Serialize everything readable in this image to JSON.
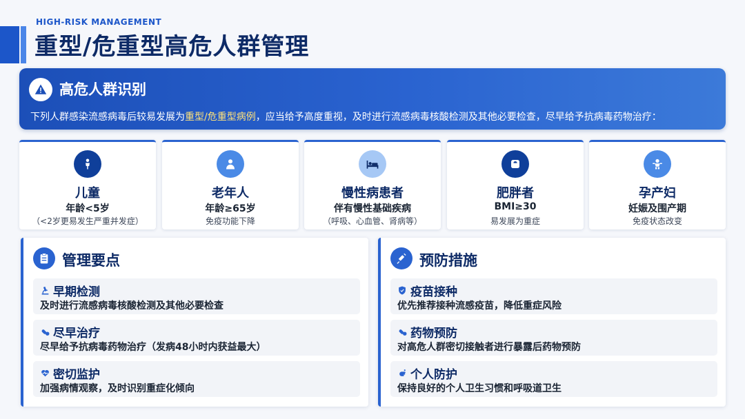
{
  "header": {
    "subtitle": "HIGH-RISK MANAGEMENT",
    "title": "重型/危重型高危人群管理"
  },
  "banner": {
    "icon": "warning-icon",
    "title": "高危人群识别",
    "desc_before": "下列人群感染流感病毒后较易发展为",
    "desc_highlight": "重型/危重型病例",
    "desc_after": "，应当给予高度重视，及时进行流感病毒核酸检测及其他必要检查，尽早给予抗病毒药物治疗："
  },
  "groups": [
    {
      "icon": "child-icon",
      "name": "儿童",
      "criterion": "年龄<5岁",
      "note": "（<2岁更易发生严重并发症）"
    },
    {
      "icon": "elderly-icon",
      "name": "老年人",
      "criterion": "年龄≥65岁",
      "note": "免疫功能下降"
    },
    {
      "icon": "hospital-bed-icon",
      "name": "慢性病患者",
      "criterion": "伴有慢性基础疾病",
      "note": "（呼吸、心血管、肾病等）"
    },
    {
      "icon": "weight-scale-icon",
      "name": "肥胖者",
      "criterion": "BMI≥30",
      "note": "易发展为重症"
    },
    {
      "icon": "baby-icon",
      "name": "孕产妇",
      "criterion": "妊娠及围产期",
      "note": "免疫状态改变"
    }
  ],
  "management": {
    "icon": "clipboard-icon",
    "title": "管理要点",
    "items": [
      {
        "icon": "microscope-icon",
        "title": "早期检测",
        "desc": "及时进行流感病毒核酸检测及其他必要检查"
      },
      {
        "icon": "pills-icon",
        "title": "尽早治疗",
        "desc": "尽早给予抗病毒药物治疗（发病48小时内获益最大）"
      },
      {
        "icon": "heartbeat-icon",
        "title": "密切监护",
        "desc": "加强病情观察，及时识别重症化倾向"
      }
    ]
  },
  "prevention": {
    "icon": "syringe-icon",
    "title": "预防措施",
    "items": [
      {
        "icon": "shield-icon",
        "title": "疫苗接种",
        "desc": "优先推荐接种流感疫苗，降低重症风险"
      },
      {
        "icon": "pills-icon",
        "title": "药物预防",
        "desc": "对高危人群密切接触者进行暴露后药物预防"
      },
      {
        "icon": "hand-wash-icon",
        "title": "个人防护",
        "desc": "保持良好的个人卫生习惯和呼吸道卫生"
      }
    ]
  },
  "colors": {
    "primary": "#1c56c9",
    "dark": "#0d2a66",
    "highlight": "#ffe27a"
  }
}
